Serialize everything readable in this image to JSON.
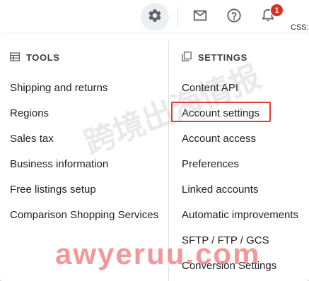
{
  "toolbar": {
    "icons": [
      "gear-icon",
      "mail-icon",
      "help-icon",
      "bell-icon"
    ],
    "notification_count": "1",
    "css_label": "CSS:"
  },
  "tools": {
    "heading": "TOOLS",
    "items": [
      {
        "label": "Shipping and returns"
      },
      {
        "label": "Regions"
      },
      {
        "label": "Sales tax"
      },
      {
        "label": "Business information"
      },
      {
        "label": "Free listings setup"
      },
      {
        "label": "Comparison Shopping Services"
      }
    ]
  },
  "settings": {
    "heading": "SETTINGS",
    "items": [
      {
        "label": "Content API"
      },
      {
        "label": "Account settings",
        "highlighted": true
      },
      {
        "label": "Account access"
      },
      {
        "label": "Preferences"
      },
      {
        "label": "Linked accounts"
      },
      {
        "label": "Automatic improvements"
      },
      {
        "label": "SFTP / FTP / GCS"
      },
      {
        "label": "Conversion Settings"
      }
    ]
  },
  "colors": {
    "highlight_border": "#e53935",
    "badge": "#d93025",
    "text": "#202124"
  },
  "watermark": {
    "chinese": "跨境出海情报",
    "url": "awyeruu.com"
  }
}
